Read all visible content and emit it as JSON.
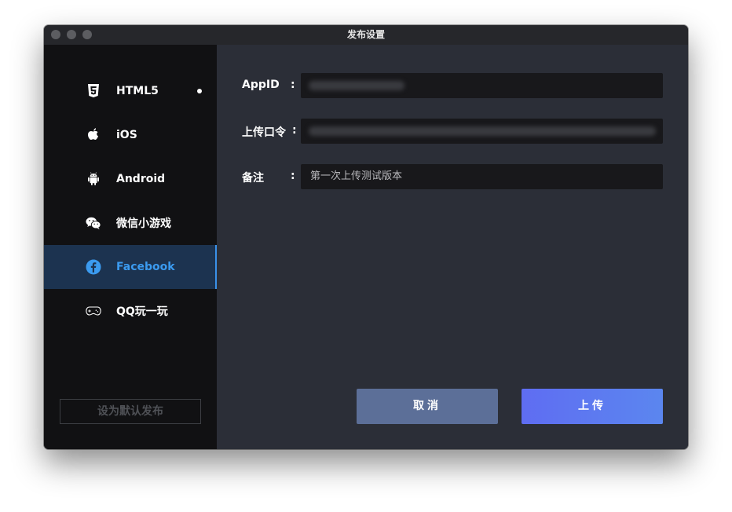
{
  "window": {
    "title": "发布设置"
  },
  "sidebar": {
    "items": [
      {
        "label": "HTML5",
        "icon": "html5-icon",
        "has_dot": true
      },
      {
        "label": "iOS",
        "icon": "apple-icon"
      },
      {
        "label": "Android",
        "icon": "android-icon"
      },
      {
        "label": "微信小游戏",
        "icon": "wechat-icon"
      },
      {
        "label": "Facebook",
        "icon": "facebook-icon",
        "active": true
      },
      {
        "label": "QQ玩一玩",
        "icon": "gamepad-icon"
      }
    ],
    "default_button_label": "设为默认发布"
  },
  "form": {
    "appid": {
      "label": "AppID",
      "value_hidden": true
    },
    "upload_token": {
      "label": "上传口令",
      "value_hidden": true
    },
    "note": {
      "label": "备注",
      "value": "第一次上传测试版本"
    },
    "colon": ":"
  },
  "buttons": {
    "cancel_label": "取消",
    "upload_label": "上传"
  },
  "colors": {
    "accent": "#3b9bf0",
    "sidebar_active_bg": "#1c3350",
    "cancel_bg": "#5c6f98",
    "upload_bg": "#5f6df2"
  }
}
